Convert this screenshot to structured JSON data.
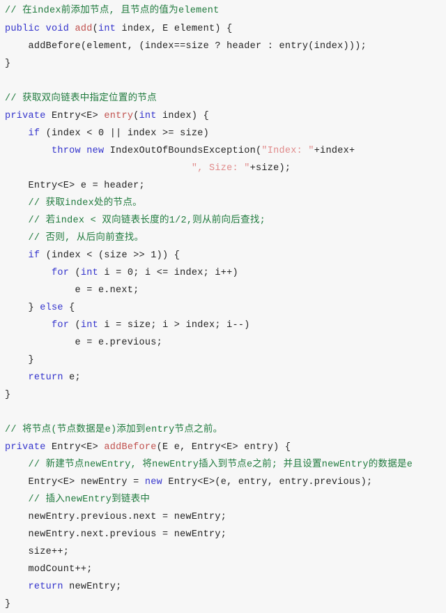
{
  "editor": {
    "background_color": "#f7f7f7",
    "language": "java",
    "font_size_px": 13.5,
    "line_height_px": 25,
    "colors": {
      "comment": "#1f7a3d",
      "keyword": "#3333cc",
      "method": "#c0504d",
      "string": "#e08a8a",
      "plain": "#222222"
    }
  },
  "code": {
    "lines": [
      {
        "id": "line-1",
        "tokens": [
          {
            "t": "comment",
            "s": "// 在index前添加节点, 且节点的值为element"
          }
        ]
      },
      {
        "id": "line-2",
        "tokens": [
          {
            "t": "keyword",
            "s": "public"
          },
          {
            "t": "plain",
            "s": " "
          },
          {
            "t": "keyword",
            "s": "void"
          },
          {
            "t": "plain",
            "s": " "
          },
          {
            "t": "method",
            "s": "add"
          },
          {
            "t": "plain",
            "s": "("
          },
          {
            "t": "keyword",
            "s": "int"
          },
          {
            "t": "plain",
            "s": " index, E element) {"
          }
        ]
      },
      {
        "id": "line-3",
        "tokens": [
          {
            "t": "plain",
            "s": "    addBefore(element, (index==size ? header : entry(index)));"
          }
        ]
      },
      {
        "id": "line-4",
        "tokens": [
          {
            "t": "plain",
            "s": "}"
          }
        ]
      },
      {
        "id": "line-5",
        "tokens": [
          {
            "t": "plain",
            "s": ""
          }
        ]
      },
      {
        "id": "line-6",
        "tokens": [
          {
            "t": "comment",
            "s": "// 获取双向链表中指定位置的节点"
          }
        ]
      },
      {
        "id": "line-7",
        "tokens": [
          {
            "t": "keyword",
            "s": "private"
          },
          {
            "t": "plain",
            "s": " Entry<E> "
          },
          {
            "t": "method",
            "s": "entry"
          },
          {
            "t": "plain",
            "s": "("
          },
          {
            "t": "keyword",
            "s": "int"
          },
          {
            "t": "plain",
            "s": " index) {"
          }
        ]
      },
      {
        "id": "line-8",
        "tokens": [
          {
            "t": "plain",
            "s": "    "
          },
          {
            "t": "keyword",
            "s": "if"
          },
          {
            "t": "plain",
            "s": " (index < 0 || index >= size)"
          }
        ]
      },
      {
        "id": "line-9",
        "tokens": [
          {
            "t": "plain",
            "s": "        "
          },
          {
            "t": "keyword",
            "s": "throw"
          },
          {
            "t": "plain",
            "s": " "
          },
          {
            "t": "keyword",
            "s": "new"
          },
          {
            "t": "plain",
            "s": " IndexOutOfBoundsException("
          },
          {
            "t": "string",
            "s": "\"Index: \""
          },
          {
            "t": "plain",
            "s": "+index+"
          }
        ]
      },
      {
        "id": "line-10",
        "tokens": [
          {
            "t": "plain",
            "s": "                                "
          },
          {
            "t": "string",
            "s": "\", Size: \""
          },
          {
            "t": "plain",
            "s": "+size);"
          }
        ]
      },
      {
        "id": "line-11",
        "tokens": [
          {
            "t": "plain",
            "s": "    Entry<E> e = header;"
          }
        ]
      },
      {
        "id": "line-12",
        "tokens": [
          {
            "t": "plain",
            "s": "    "
          },
          {
            "t": "comment",
            "s": "// 获取index处的节点。"
          }
        ]
      },
      {
        "id": "line-13",
        "tokens": [
          {
            "t": "plain",
            "s": "    "
          },
          {
            "t": "comment",
            "s": "// 若index < 双向链表长度的1/2,则从前向后查找;"
          }
        ]
      },
      {
        "id": "line-14",
        "tokens": [
          {
            "t": "plain",
            "s": "    "
          },
          {
            "t": "comment",
            "s": "// 否则, 从后向前查找。"
          }
        ]
      },
      {
        "id": "line-15",
        "tokens": [
          {
            "t": "plain",
            "s": "    "
          },
          {
            "t": "keyword",
            "s": "if"
          },
          {
            "t": "plain",
            "s": " (index < (size >> 1)) {"
          }
        ]
      },
      {
        "id": "line-16",
        "tokens": [
          {
            "t": "plain",
            "s": "        "
          },
          {
            "t": "keyword",
            "s": "for"
          },
          {
            "t": "plain",
            "s": " ("
          },
          {
            "t": "keyword",
            "s": "int"
          },
          {
            "t": "plain",
            "s": " i = 0; i <= index; i++)"
          }
        ]
      },
      {
        "id": "line-17",
        "tokens": [
          {
            "t": "plain",
            "s": "            e = e.next;"
          }
        ]
      },
      {
        "id": "line-18",
        "tokens": [
          {
            "t": "plain",
            "s": "    } "
          },
          {
            "t": "keyword",
            "s": "else"
          },
          {
            "t": "plain",
            "s": " {"
          }
        ]
      },
      {
        "id": "line-19",
        "tokens": [
          {
            "t": "plain",
            "s": "        "
          },
          {
            "t": "keyword",
            "s": "for"
          },
          {
            "t": "plain",
            "s": " ("
          },
          {
            "t": "keyword",
            "s": "int"
          },
          {
            "t": "plain",
            "s": " i = size; i > index; i--)"
          }
        ]
      },
      {
        "id": "line-20",
        "tokens": [
          {
            "t": "plain",
            "s": "            e = e.previous;"
          }
        ]
      },
      {
        "id": "line-21",
        "tokens": [
          {
            "t": "plain",
            "s": "    }"
          }
        ]
      },
      {
        "id": "line-22",
        "tokens": [
          {
            "t": "plain",
            "s": "    "
          },
          {
            "t": "keyword",
            "s": "return"
          },
          {
            "t": "plain",
            "s": " e;"
          }
        ]
      },
      {
        "id": "line-23",
        "tokens": [
          {
            "t": "plain",
            "s": "}"
          }
        ]
      },
      {
        "id": "line-24",
        "tokens": [
          {
            "t": "plain",
            "s": ""
          }
        ]
      },
      {
        "id": "line-25",
        "tokens": [
          {
            "t": "comment",
            "s": "// 将节点(节点数据是e)添加到entry节点之前。"
          }
        ]
      },
      {
        "id": "line-26",
        "tokens": [
          {
            "t": "keyword",
            "s": "private"
          },
          {
            "t": "plain",
            "s": " Entry<E> "
          },
          {
            "t": "method",
            "s": "addBefore"
          },
          {
            "t": "plain",
            "s": "(E e, Entry<E> entry) {"
          }
        ]
      },
      {
        "id": "line-27",
        "tokens": [
          {
            "t": "plain",
            "s": "    "
          },
          {
            "t": "comment",
            "s": "// 新建节点newEntry, 将newEntry插入到节点e之前; 并且设置newEntry的数据是e"
          }
        ]
      },
      {
        "id": "line-28",
        "tokens": [
          {
            "t": "plain",
            "s": "    Entry<E> newEntry = "
          },
          {
            "t": "keyword",
            "s": "new"
          },
          {
            "t": "plain",
            "s": " Entry<E>(e, entry, entry.previous);"
          }
        ]
      },
      {
        "id": "line-29",
        "tokens": [
          {
            "t": "plain",
            "s": "    "
          },
          {
            "t": "comment",
            "s": "// 插入newEntry到链表中"
          }
        ]
      },
      {
        "id": "line-30",
        "tokens": [
          {
            "t": "plain",
            "s": "    newEntry.previous.next = newEntry;"
          }
        ]
      },
      {
        "id": "line-31",
        "tokens": [
          {
            "t": "plain",
            "s": "    newEntry.next.previous = newEntry;"
          }
        ]
      },
      {
        "id": "line-32",
        "tokens": [
          {
            "t": "plain",
            "s": "    size++;"
          }
        ]
      },
      {
        "id": "line-33",
        "tokens": [
          {
            "t": "plain",
            "s": "    modCount++;"
          }
        ]
      },
      {
        "id": "line-34",
        "tokens": [
          {
            "t": "plain",
            "s": "    "
          },
          {
            "t": "keyword",
            "s": "return"
          },
          {
            "t": "plain",
            "s": " newEntry;"
          }
        ]
      },
      {
        "id": "line-35",
        "tokens": [
          {
            "t": "plain",
            "s": "}"
          }
        ]
      }
    ]
  }
}
